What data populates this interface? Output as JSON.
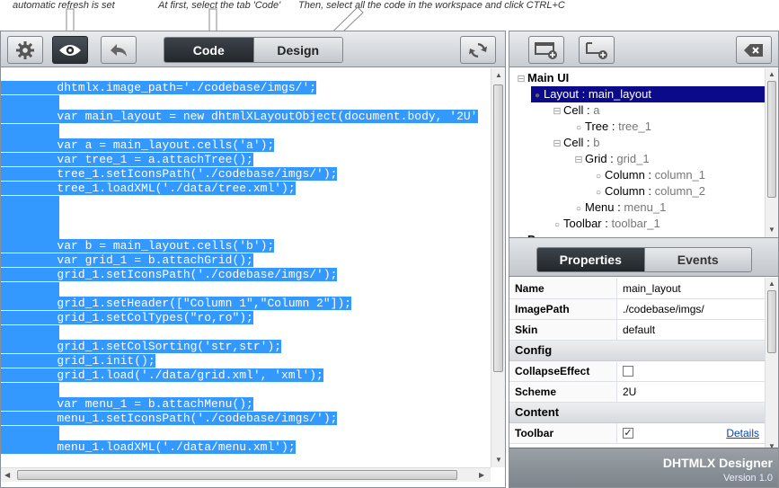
{
  "annotations": [
    "automatic refresh is set",
    "At first, select the tab 'Code'",
    "Then, select all the code in the workspace and click CTRL+C"
  ],
  "toolbar": {
    "buttons": [
      "gear-icon",
      "eye-icon",
      "undo-icon"
    ],
    "tabs": [
      "Code",
      "Design"
    ],
    "refresh_icon": "refresh-icon"
  },
  "code_lines": [
    "        dhtmlx.image_path='./codebase/imgs/';",
    "",
    "        var main_layout = new dhtmlXLayoutObject(document.body, '2U'",
    "",
    "        var a = main_layout.cells('a');",
    "        var tree_1 = a.attachTree();",
    "        tree_1.setIconsPath('./codebase/imgs/');",
    "        tree_1.loadXML('./data/tree.xml');",
    "",
    "",
    "",
    "        var b = main_layout.cells('b');",
    "        var grid_1 = b.attachGrid();",
    "        grid_1.setIconsPath('./codebase/imgs/');",
    "",
    "        grid_1.setHeader([\"Column 1\",\"Column 2\"]);",
    "        grid_1.setColTypes(\"ro,ro\");",
    "",
    "        grid_1.setColSorting('str,str');",
    "        grid_1.init();",
    "        grid_1.load('./data/grid.xml', 'xml');",
    "",
    "        var menu_1 = b.attachMenu();",
    "        menu_1.setIconsPath('./codebase/imgs/');",
    "",
    "        menu_1.loadXML('./data/menu.xml');"
  ],
  "right_toolbar": {
    "buttons": [
      "add-window-icon",
      "add-popup-icon"
    ],
    "close_icon": "backspace-icon"
  },
  "tree": [
    {
      "toggle": "⊟",
      "type": "Main UI",
      "name": "",
      "bold": true
    },
    {
      "toggle": "",
      "bullet": "●",
      "type": "Layout",
      "sep": " : ",
      "name": "main_layout",
      "selected": true
    },
    {
      "toggle": "⊟",
      "type": "Cell",
      "sep": " : ",
      "name": "a"
    },
    {
      "toggle": "",
      "bullet": "○",
      "type": "Tree",
      "sep": " : ",
      "name": "tree_1"
    },
    {
      "toggle": "⊟",
      "type": "Cell",
      "sep": " : ",
      "name": "b"
    },
    {
      "toggle": "⊟",
      "type": "Grid",
      "sep": " : ",
      "name": "grid_1"
    },
    {
      "toggle": "",
      "bullet": "○",
      "type": "Column",
      "sep": " : ",
      "name": "column_1"
    },
    {
      "toggle": "",
      "bullet": "○",
      "type": "Column",
      "sep": " : ",
      "name": "column_2"
    },
    {
      "toggle": "",
      "bullet": "○",
      "type": "Menu",
      "sep": " : ",
      "name": "menu_1"
    },
    {
      "toggle": "",
      "bullet": "○",
      "type": "Toolbar",
      "sep": " : ",
      "name": "toolbar_1"
    },
    {
      "toggle": "⊟",
      "type": "Popups",
      "name": "",
      "bold": true
    }
  ],
  "prop_tabs": [
    "Properties",
    "Events"
  ],
  "properties": [
    {
      "kind": "row",
      "name": "Name",
      "value": "main_layout"
    },
    {
      "kind": "row",
      "name": "ImagePath",
      "value": "./codebase/imgs/"
    },
    {
      "kind": "row",
      "name": "Skin",
      "value": "default"
    },
    {
      "kind": "group",
      "name": "Config"
    },
    {
      "kind": "row",
      "name": "CollapseEffect",
      "checkbox": true,
      "checked": false
    },
    {
      "kind": "row",
      "name": "Scheme",
      "value": "2U"
    },
    {
      "kind": "group",
      "name": "Content"
    },
    {
      "kind": "row",
      "name": "Toolbar",
      "checkbox": true,
      "checked": true,
      "link": "Details"
    }
  ],
  "footer": {
    "brand": "DHTMLX Designer",
    "version": "Version 1.0"
  },
  "colors": {
    "selection": "#3399ff",
    "tree_selected": "#0a0a8a",
    "link": "#0645ad"
  }
}
